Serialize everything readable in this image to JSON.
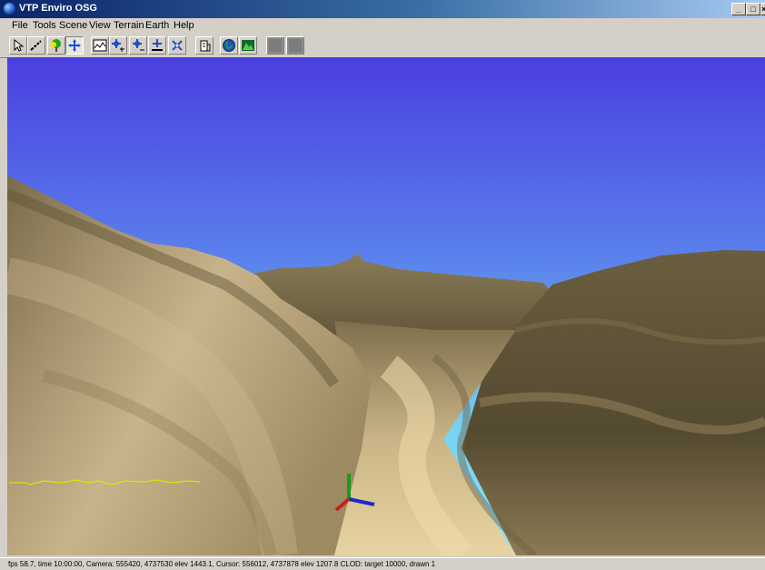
{
  "window": {
    "title": "VTP Enviro OSG",
    "controls": {
      "minimize": "_",
      "maximize": "□",
      "close": "×"
    }
  },
  "menu": [
    "File",
    "Tools",
    "Scene",
    "View",
    "Terrain",
    "Earth",
    "Help"
  ],
  "toolbar": {
    "buttons": [
      "select-icon",
      "measure-icon",
      "plant-icon",
      "navigate-icon",
      "terrain-icon",
      "zoom-in-icon",
      "zoom-out-icon",
      "flatten-icon",
      "expand-icon",
      "structure-icon",
      "globe-icon",
      "map-icon",
      "gray-button-icon",
      "gray-button-icon"
    ],
    "pressed": "navigate-icon"
  },
  "colors": {
    "sky_top": "#4a3fe0",
    "sky_horizon": "#78d2f0",
    "terrain_dark": "#5d5238",
    "terrain_light": "#e2cc94",
    "overlay_graph": "#e6e000"
  },
  "status": {
    "text": "fps 58.7, time 10:00:00, Camera:  555420, 4737530 elev 1443.1, Cursor:  556012, 4737878 elev 1207.8 CLOD: target 10000, drawn 1"
  }
}
